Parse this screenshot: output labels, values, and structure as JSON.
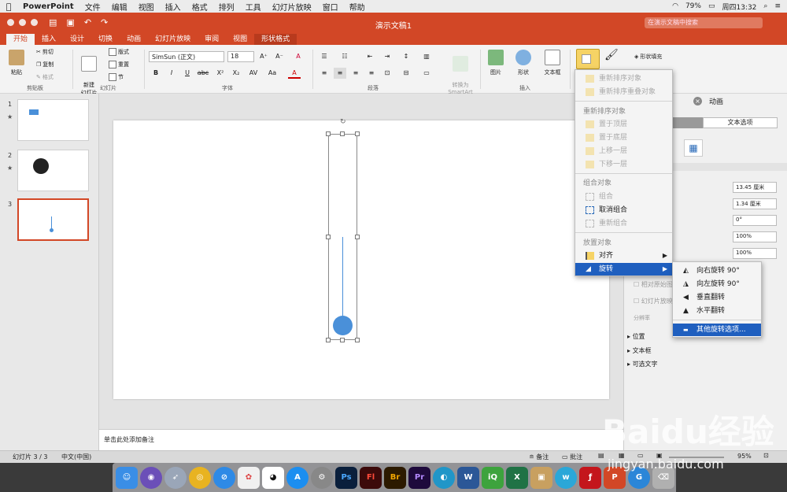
{
  "menubar": {
    "app": "PowerPoint",
    "items": [
      "文件",
      "编辑",
      "视图",
      "插入",
      "格式",
      "排列",
      "工具",
      "幻灯片放映",
      "窗口",
      "帮助"
    ],
    "battery": "79%",
    "clock": "周四13:32"
  },
  "window": {
    "title": "演示文稿1",
    "search_placeholder": "在演示文稿中搜索"
  },
  "tabs": [
    "开始",
    "插入",
    "设计",
    "切换",
    "动画",
    "幻灯片放映",
    "审阅",
    "视图",
    "形状格式"
  ],
  "ribbon": {
    "paste": "粘贴",
    "cut": "剪切",
    "copy": "复制",
    "format": "格式",
    "clipboard_group": "剪贴板",
    "new_slide": "新建\n幻灯片",
    "layout": "版式",
    "reset": "重置",
    "section": "节",
    "slides_group": "幻灯片",
    "font_name": "SimSun (正文)",
    "font_size": "18",
    "font_group": "字体",
    "paragraph_group": "段落",
    "smartart": "转换为\nSmartArt",
    "picture": "图片",
    "shapes": "形状",
    "textbox": "文本框",
    "insert_group": "插入",
    "shape_fill": "形状填充"
  },
  "slides": [
    {
      "num": "1",
      "star": "★"
    },
    {
      "num": "2",
      "star": "★"
    },
    {
      "num": "3",
      "star": ""
    }
  ],
  "notes_placeholder": "单击此处添加备注",
  "status": {
    "slide_info": "幻灯片 3 / 3",
    "language": "中文(中国)",
    "notes": "备注",
    "comments": "批注",
    "zoom": "95%"
  },
  "arrange_menu": {
    "items": [
      {
        "label": "重新排序对象",
        "enabled": false
      },
      {
        "label": "重新排序重叠对象",
        "enabled": false
      },
      {
        "label": "重新排序对象",
        "heading": true
      },
      {
        "label": "置于顶层",
        "enabled": false
      },
      {
        "label": "置于底层",
        "enabled": false
      },
      {
        "label": "上移一层",
        "enabled": false
      },
      {
        "label": "下移一层",
        "enabled": false
      },
      {
        "label": "组合对象",
        "heading": true
      },
      {
        "label": "组合",
        "enabled": false
      },
      {
        "label": "取消组合",
        "enabled": true
      },
      {
        "label": "重新组合",
        "enabled": false
      },
      {
        "label": "放置对象",
        "heading": true
      },
      {
        "label": "对齐",
        "enabled": true,
        "submenu": true
      },
      {
        "label": "旋转",
        "enabled": true,
        "submenu": true,
        "highlighted": true
      }
    ]
  },
  "rotate_submenu": {
    "items": [
      {
        "label": "向右旋转 90°"
      },
      {
        "label": "向左旋转 90°"
      },
      {
        "label": "垂直翻转"
      },
      {
        "label": "水平翻转"
      },
      {
        "label": "其他旋转选项...",
        "highlighted": true
      }
    ]
  },
  "format_pane": {
    "title": "动画",
    "tab_text_options": "文本选项",
    "fields": [
      "13.45 厘米",
      "1.34 厘米",
      "0°",
      "100%",
      "100%"
    ],
    "checkbox1": "相对原始图",
    "checkbox2": "幻灯片放映",
    "resolution": "分辨率",
    "sections": [
      "位置",
      "文本框",
      "可选文字"
    ]
  },
  "watermark": {
    "logo": "Baidu经验",
    "url": "jingyan.baidu.com"
  },
  "colors": {
    "accent": "#d24726",
    "menu_highlight": "#1f5fbf",
    "shape_blue": "#4a90d9"
  }
}
